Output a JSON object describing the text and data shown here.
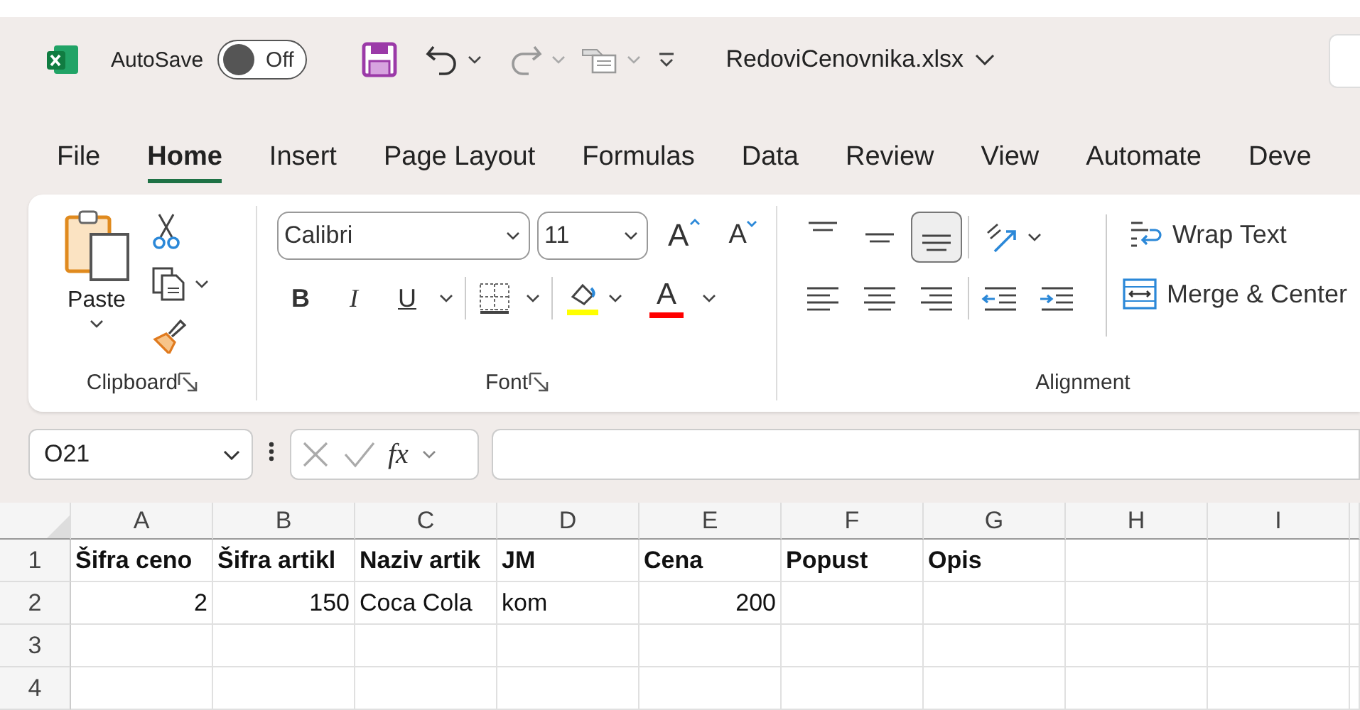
{
  "title_bar": {
    "autosave_label": "AutoSave",
    "autosave_toggle": {
      "label": "Off",
      "on": false
    },
    "file_name": "RedoviCenovnika.xlsx"
  },
  "tabs": [
    {
      "label": "File",
      "selected": false
    },
    {
      "label": "Home",
      "selected": true
    },
    {
      "label": "Insert",
      "selected": false
    },
    {
      "label": "Page Layout",
      "selected": false
    },
    {
      "label": "Formulas",
      "selected": false
    },
    {
      "label": "Data",
      "selected": false
    },
    {
      "label": "Review",
      "selected": false
    },
    {
      "label": "View",
      "selected": false
    },
    {
      "label": "Automate",
      "selected": false
    },
    {
      "label": "Deve",
      "selected": false
    }
  ],
  "ribbon": {
    "clipboard": {
      "paste_label": "Paste",
      "group_label": "Clipboard"
    },
    "font": {
      "font_name": "Calibri",
      "font_size": "11",
      "grow_font": "A",
      "shrink_font": "A",
      "bold": "B",
      "italic": "I",
      "underline": "U",
      "font_color": "A",
      "group_label": "Font"
    },
    "alignment": {
      "vertical_buttons": [
        {
          "kind": "top",
          "selected": false
        },
        {
          "kind": "middle",
          "selected": false
        },
        {
          "kind": "bottom",
          "selected": true
        }
      ],
      "wrap_text": "Wrap Text",
      "merge_center": "Merge & Center",
      "group_label": "Alignment"
    }
  },
  "formula_bar": {
    "name_box": "O21",
    "fx_label": "fx"
  },
  "sheet": {
    "columns": [
      "A",
      "B",
      "C",
      "D",
      "E",
      "F",
      "G",
      "H",
      "I"
    ],
    "rows": [
      {
        "number": "1",
        "bold": true,
        "cells": [
          {
            "text": "Šifra ceno",
            "kind": "text"
          },
          {
            "text": "Šifra artikl",
            "kind": "text"
          },
          {
            "text": "Naziv artik",
            "kind": "text"
          },
          {
            "text": "JM",
            "kind": "text"
          },
          {
            "text": "Cena",
            "kind": "text"
          },
          {
            "text": "Popust",
            "kind": "text"
          },
          {
            "text": "Opis",
            "kind": "text"
          }
        ]
      },
      {
        "number": "2",
        "bold": false,
        "cells": [
          {
            "text": "2",
            "kind": "number"
          },
          {
            "text": "150",
            "kind": "number"
          },
          {
            "text": "Coca Cola",
            "kind": "text"
          },
          {
            "text": "kom",
            "kind": "text"
          },
          {
            "text": "200",
            "kind": "number"
          }
        ]
      },
      {
        "number": "3"
      },
      {
        "number": "4"
      }
    ]
  }
}
